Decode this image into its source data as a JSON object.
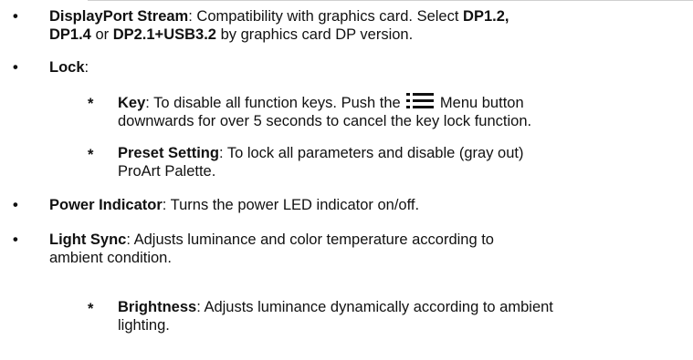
{
  "items": {
    "displayport": {
      "bullet": "•",
      "term": "DisplayPort Stream",
      "t1": ": Compatibility with graphics card. Select ",
      "opt1": "DP1.2,",
      "line2_opt2": "DP1.4",
      "t2": " or ",
      "opt3": "DP2.1+USB3.2",
      "t3": " by graphics card DP version."
    },
    "lock": {
      "bullet": "•",
      "term": "Lock",
      "colon": ":",
      "key": {
        "star": "*",
        "term": "Key",
        "t1": ": To disable all function keys. Push the ",
        "t2": " Menu button",
        "line2": "downwards for over 5 seconds to cancel the key lock function."
      },
      "preset": {
        "star": "*",
        "term": "Preset Setting",
        "t1": ": To lock all parameters and disable (gray out)",
        "line2": "ProArt Palette."
      }
    },
    "power": {
      "bullet": "•",
      "term": "Power Indicator",
      "t1": ": Turns the power LED indicator on/off."
    },
    "lightsync": {
      "bullet": "•",
      "term": "Light Sync",
      "t1": ": Adjusts luminance and color temperature according to",
      "line2": "ambient condition.",
      "brightness": {
        "star": "*",
        "term": "Brightness",
        "t1": ": Adjusts luminance dynamically according to ambient",
        "line2": "lighting."
      }
    }
  },
  "icons": {
    "menu": "menu-icon"
  }
}
